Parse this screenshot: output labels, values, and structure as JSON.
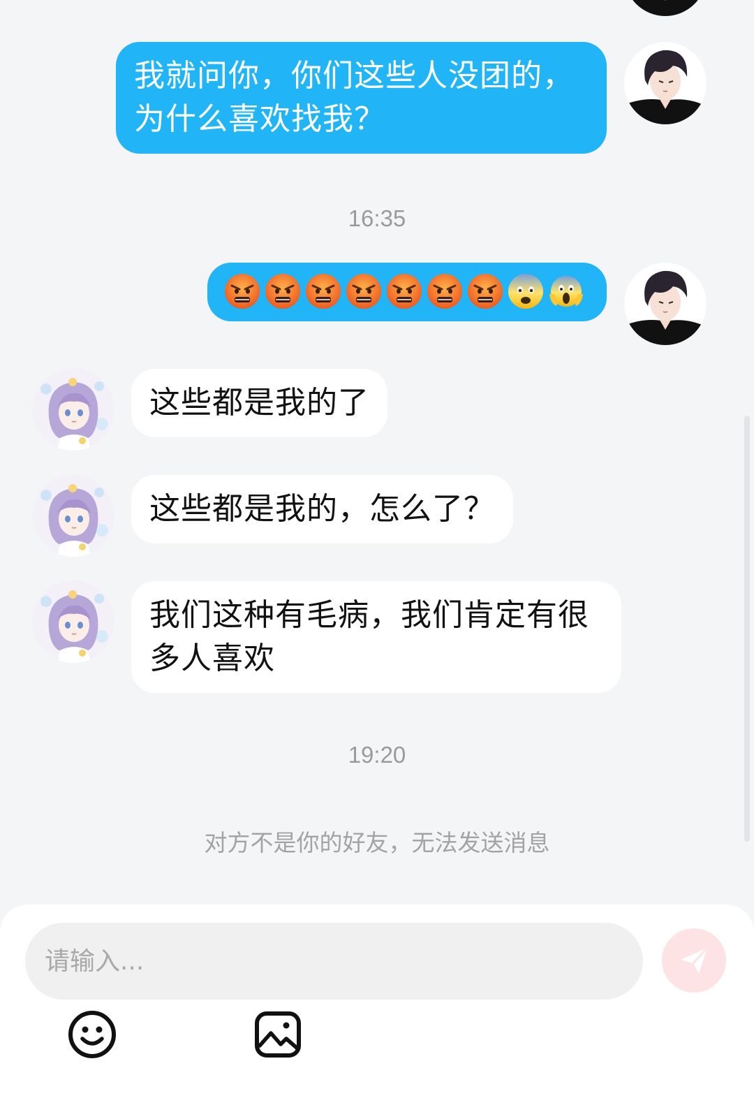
{
  "messages": [
    {
      "side": "sent",
      "text_lines": [
        "我就问你，你们这些人没团的，",
        "为什么喜欢找我？"
      ]
    },
    {
      "side": "time",
      "text": "16:35"
    },
    {
      "side": "sent",
      "emojis": [
        "angry-face",
        "angry-face",
        "angry-face",
        "angry-face",
        "angry-face",
        "angry-face",
        "angry-face",
        "fearful-face",
        "screaming-face"
      ]
    },
    {
      "side": "recv",
      "text": "这些都是我的了"
    },
    {
      "side": "recv",
      "text": "这些都是我的，怎么了？"
    },
    {
      "side": "recv",
      "text_lines": [
        "我们这种有毛病，我们肯定有很",
        "多人喜欢"
      ]
    },
    {
      "side": "time",
      "text": "19:20"
    }
  ],
  "notice": "对方不是你的好友，无法发送消息",
  "composer": {
    "placeholder": "请输入...",
    "send_icon": "send-icon",
    "tools": [
      "emoji-icon",
      "image-icon"
    ]
  },
  "colors": {
    "sent_bubble": "#21b5f7",
    "recv_bubble": "#ffffff",
    "background": "#f4f5f7",
    "send_button": "#fde3e3"
  }
}
